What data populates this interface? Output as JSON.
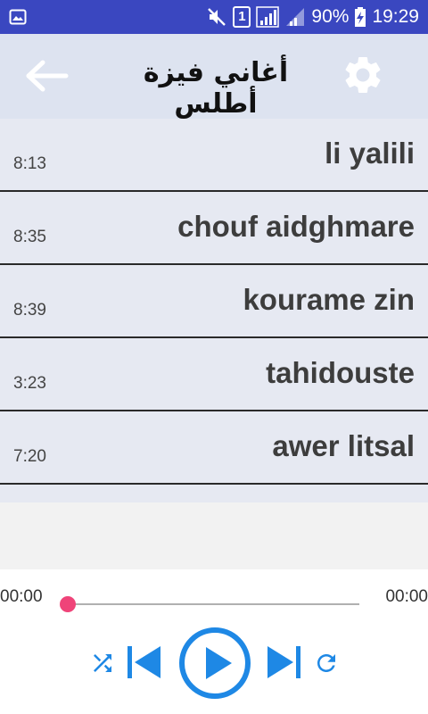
{
  "status_bar": {
    "battery": "90%",
    "time": "19:29",
    "sim_badge": "1",
    "icons": [
      "gallery-icon",
      "mute-icon",
      "signal-icon",
      "battery-charging-icon"
    ]
  },
  "app_bar": {
    "title": "أغاني فيزة أطلس",
    "icons": [
      "back-arrow-icon",
      "gear-icon"
    ]
  },
  "songs": [
    {
      "title": "li yalili",
      "duration": "8:13"
    },
    {
      "title": "chouf aidghmare",
      "duration": "8:35"
    },
    {
      "title": "kourame zin",
      "duration": "8:39"
    },
    {
      "title": "tahidouste",
      "duration": "3:23"
    },
    {
      "title": "awer litsal",
      "duration": "7:20"
    }
  ],
  "player": {
    "current_time": "00:00",
    "total_time": "00:00",
    "progress": 0,
    "icons": [
      "shuffle-icon",
      "previous-icon",
      "play-icon",
      "next-icon",
      "repeat-icon"
    ]
  },
  "colors": {
    "status_bar": "#3a47c0",
    "app_bar": "#dde3f0",
    "row_background": "#e6e9f2",
    "accent_blue": "#1e88e5",
    "progress_thumb": "#ef4479"
  }
}
